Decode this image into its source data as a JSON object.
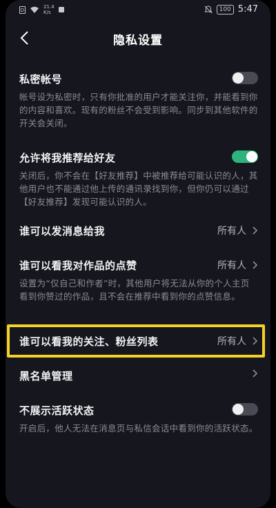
{
  "status_bar": {
    "sim_label": "D",
    "net_speed_value": "21.4",
    "net_speed_unit": "K/s",
    "battery": "100",
    "time": "5:47"
  },
  "header": {
    "title": "隐私设置"
  },
  "settings": {
    "private_account": {
      "title": "私密帐号",
      "desc": "帐号设为私密时，只有你批准的用户才能关注你，并能看到你的内容和喜欢。现有的粉丝不会受到影响。同步到其他软件的开关会关闭。",
      "enabled": false
    },
    "recommend_friends": {
      "title": "允许将我推荐给好友",
      "desc": "关闭后，你不会在【好友推荐】中被推荐给可能认识的人，其他用户也不能通过他上传的通讯录找到你，但你仍可以通过【好友推荐】发现可能认识的人。",
      "enabled": true
    },
    "who_can_message": {
      "title": "谁可以发消息给我",
      "value": "所有人"
    },
    "who_can_see_likes": {
      "title": "谁可以看我对作品的点赞",
      "value": "所有人",
      "desc": "设置为“仅自己和作者”时，其他用户将无法从你的个人主页看到你赞过的作品，且不会在推荐中看到你的点赞信息。"
    },
    "who_can_see_follow_lists": {
      "title": "谁可以看我的关注、粉丝列表",
      "value": "所有人"
    },
    "blacklist": {
      "title": "黑名单管理"
    },
    "hide_active_status": {
      "title": "不展示活跃状态",
      "desc": "开启后，他人无法在消息页与私信会话中看到你的活跃状态。",
      "enabled": false
    }
  },
  "colors": {
    "background": "#15161e",
    "toggle_on": "#2fb37c",
    "toggle_off": "#4a4b52",
    "highlight": "#f5d227",
    "secondary_text": "#8a8b93"
  }
}
